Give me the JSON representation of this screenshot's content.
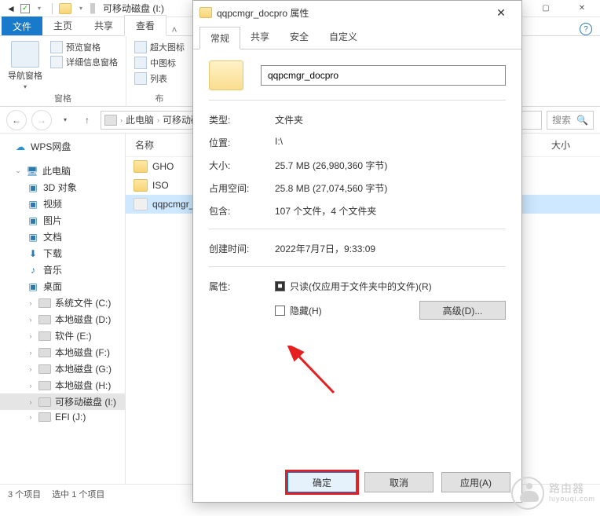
{
  "titlebar": {
    "title": "可移动磁盘 (I:)"
  },
  "window_controls": {
    "min": "—",
    "max": "▢",
    "close": "✕"
  },
  "ribbon_tabs": {
    "file": "文件",
    "home": "主页",
    "share": "共享",
    "view": "查看"
  },
  "ribbon": {
    "nav_pane": "导航窗格",
    "preview_pane": "预览窗格",
    "details_pane": "详细信息窗格",
    "panes_label": "窗格",
    "extra_large": "超大图标",
    "medium": "中图标",
    "list": "列表",
    "layout_label": "布"
  },
  "address": {
    "this_pc": "此电脑",
    "drive": "可移动磁",
    "search_placeholder": "搜索"
  },
  "tree": {
    "wps": "WPS网盘",
    "this_pc": "此电脑",
    "objects3d": "3D 对象",
    "videos": "视频",
    "pictures": "图片",
    "documents": "文档",
    "downloads": "下载",
    "music": "音乐",
    "desktop": "桌面",
    "sysfiles": "系统文件 (C:)",
    "local_d": "本地磁盘 (D:)",
    "soft_e": "软件 (E:)",
    "local_f": "本地磁盘 (F:)",
    "local_g": "本地磁盘 (G:)",
    "local_h": "本地磁盘 (H:)",
    "removable_i": "可移动磁盘 (I:)",
    "efi_j": "EFI (J:)"
  },
  "file_header": {
    "name": "名称",
    "size": "大小"
  },
  "files": {
    "gho": "GHO",
    "iso": "ISO",
    "qqpcmgr": "qqpcmgr_docpro"
  },
  "status": {
    "items": "3 个项目",
    "selected": "选中 1 个项目"
  },
  "dialog": {
    "title": "qqpcmgr_docpro 属性",
    "tabs": {
      "general": "常规",
      "sharing": "共享",
      "security": "安全",
      "customize": "自定义"
    },
    "name_value": "qqpcmgr_docpro",
    "labels": {
      "type": "类型:",
      "location": "位置:",
      "size": "大小:",
      "size_on_disk": "占用空间:",
      "contains": "包含:",
      "created": "创建时间:",
      "attributes": "属性:"
    },
    "values": {
      "type": "文件夹",
      "location": "I:\\",
      "size": "25.7 MB (26,980,360 字节)",
      "size_on_disk": "25.8 MB (27,074,560 字节)",
      "contains": "107 个文件，4 个文件夹",
      "created": "2022年7月7日，9:33:09"
    },
    "attr": {
      "readonly": "只读(仅应用于文件夹中的文件)(R)",
      "hidden": "隐藏(H)",
      "advanced": "高级(D)..."
    },
    "buttons": {
      "ok": "确定",
      "cancel": "取消",
      "apply": "应用(A)"
    }
  },
  "watermark": {
    "line1": "路由器",
    "line2": "luyouqi.com"
  }
}
